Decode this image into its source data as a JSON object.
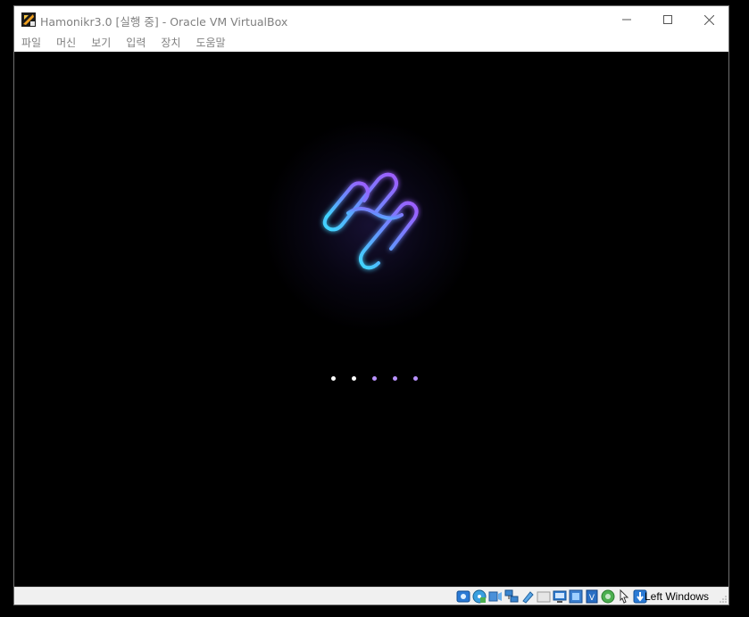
{
  "window": {
    "title": "Hamonikr3.0 [실행 중] - Oracle VM VirtualBox"
  },
  "menu": {
    "items": [
      "파일",
      "머신",
      "보기",
      "입력",
      "장치",
      "도움말"
    ]
  },
  "guest": {
    "logo_icon": "hamonikr-h-logo",
    "loading_dots": [
      {
        "color": "#ffffff"
      },
      {
        "color": "#ffffff"
      },
      {
        "color": "#b892ff"
      },
      {
        "color": "#b892ff"
      },
      {
        "color": "#b892ff"
      }
    ]
  },
  "statusbar": {
    "icons": [
      "hard-disk-icon",
      "optical-drive-icon",
      "audio-icon",
      "network-icon",
      "usb-icon",
      "shared-folders-icon",
      "display-icon",
      "video-capture-icon",
      "cpu-icon",
      "guest-additions-icon",
      "mouse-integration-icon",
      "keyboard-capture-icon"
    ],
    "host_key": "Left Windows"
  }
}
